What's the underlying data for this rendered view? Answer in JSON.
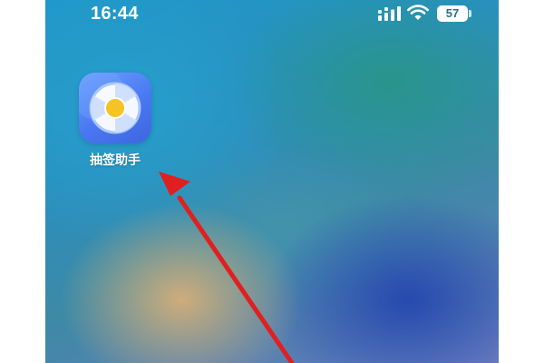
{
  "status_bar": {
    "time": "16:44",
    "battery_level": "57",
    "signal_icon": "cellular-signal-icon",
    "wifi_icon": "wifi-icon"
  },
  "home_screen": {
    "apps": [
      {
        "label": "抽签助手",
        "icon": "draw-lots-app-icon"
      }
    ]
  },
  "annotation": {
    "arrow_color": "#e02020",
    "arrow_icon": "red-pointer-arrow-icon"
  },
  "colors": {
    "app_icon_blue": "#4a78f2",
    "app_icon_center": "#f5c323"
  }
}
